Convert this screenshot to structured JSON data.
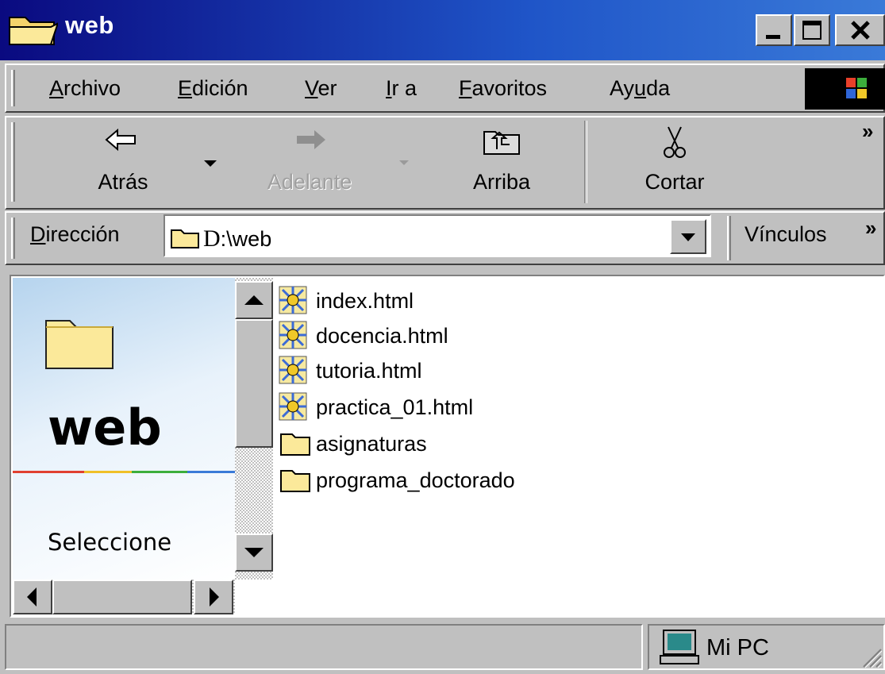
{
  "window": {
    "title": "web"
  },
  "menu": {
    "items": [
      {
        "acc": "A",
        "rest": "rchivo"
      },
      {
        "acc": "E",
        "rest": "dición"
      },
      {
        "acc": "V",
        "rest": "er"
      },
      {
        "acc": "I",
        "rest": "r a"
      },
      {
        "acc": "F",
        "rest": "avoritos"
      },
      {
        "pre": "Ay",
        "acc": "u",
        "rest": "da"
      }
    ]
  },
  "toolbar": {
    "back_label": "Atrás",
    "forward_label": "Adelante",
    "up_label": "Arriba",
    "cut_label": "Cortar",
    "more_glyph": "»"
  },
  "address": {
    "label_acc": "D",
    "label_rest": "irección",
    "drive": "D",
    "path": ":\\web",
    "links_label": "Vínculos",
    "links_more": "»"
  },
  "leftpane": {
    "folder_name": "web",
    "hint": "Seleccione"
  },
  "files": [
    {
      "name": "index.html",
      "icon": "html-doc-icon"
    },
    {
      "name": "docencia.html",
      "icon": "html-doc-icon"
    },
    {
      "name": "tutoria.html",
      "icon": "html-doc-icon"
    },
    {
      "name": "practica_01.html",
      "icon": "html-doc-icon"
    },
    {
      "name": "asignaturas",
      "icon": "folder-icon"
    },
    {
      "name": "programa_doctorado",
      "icon": "folder-icon"
    }
  ],
  "status": {
    "zone": "Mi PC"
  },
  "colors": {
    "title_bar_start": "#0a0a80",
    "title_bar_end": "#3a7ad8",
    "face": "#c0c0c0"
  }
}
